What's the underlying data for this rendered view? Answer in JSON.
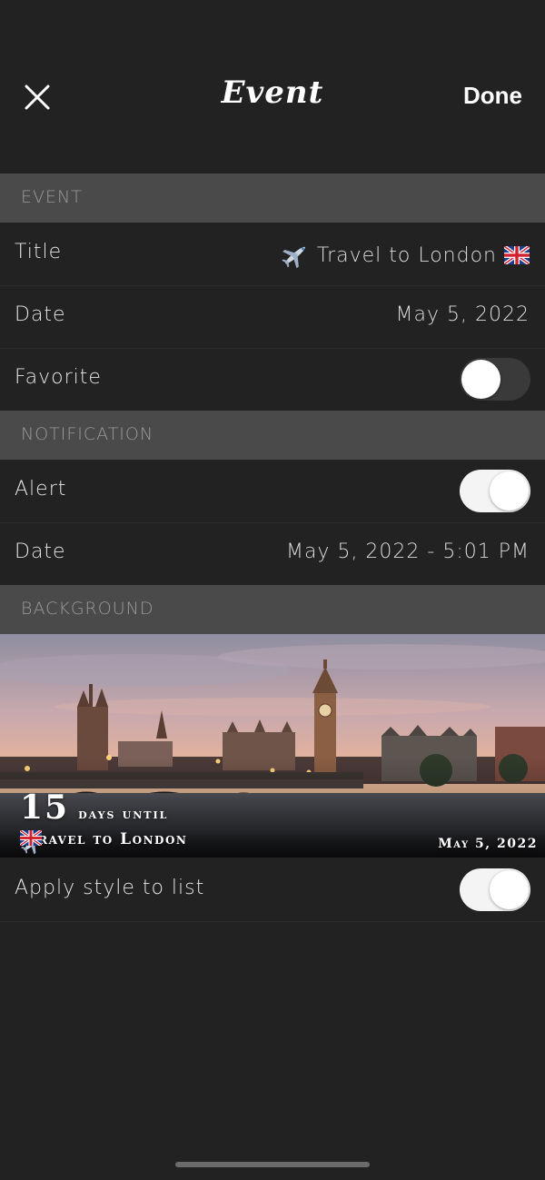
{
  "nav": {
    "title": "Event",
    "done_label": "Done",
    "close_icon": "close-icon"
  },
  "sections": {
    "event": "EVENT",
    "notification": "NOTIFICATION",
    "background": "BACKGROUND"
  },
  "event": {
    "title_label": "Title",
    "title_value": "Travel to London",
    "title_leading_icon": "airplane-icon",
    "title_trailing_icon": "uk-flag-icon",
    "date_label": "Date",
    "date_value": "May 5, 2022",
    "favorite_label": "Favorite",
    "favorite_on": false
  },
  "notification": {
    "alert_label": "Alert",
    "alert_on": true,
    "date_label": "Date",
    "date_value": "May 5, 2022 - 5:01 PM"
  },
  "background": {
    "days_count": "15",
    "days_label": "days until",
    "event_title": "Travel to London",
    "event_date": "May 5, 2022",
    "apply_label": "Apply style to list",
    "apply_on": true
  },
  "colors": {
    "background": "#222222",
    "section_header": "#4a4a4a",
    "section_text": "#9a9a9a",
    "toggle_on": "#f4f4f4",
    "toggle_off": "#3a3a3a"
  }
}
